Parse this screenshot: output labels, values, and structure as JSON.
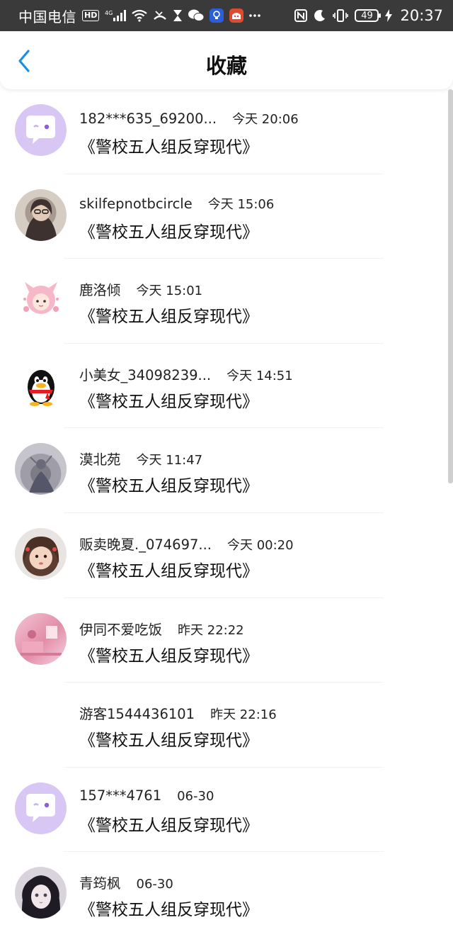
{
  "status_bar": {
    "carrier": "中国电信",
    "hd_label": "HD",
    "network": "4G",
    "battery": "49",
    "time": "20:37"
  },
  "header": {
    "title": "收藏",
    "back_icon": "chevron-left-icon",
    "accent_color": "#1a8fe3"
  },
  "list": [
    {
      "name": "182***635_69200...",
      "time": "今天 20:06",
      "book": "《警校五人组反穿现代》",
      "avatar": "chat-bubble"
    },
    {
      "name": "skilfepnotbcircle",
      "time": "今天 15:06",
      "book": "《警校五人组反穿现代》",
      "avatar": "photo"
    },
    {
      "name": "鹿洛倾",
      "time": "今天 15:01",
      "book": "《警校五人组反穿现代》",
      "avatar": "cartoon"
    },
    {
      "name": "小美女_34098239...",
      "time": "今天 14:51",
      "book": "《警校五人组反穿现代》",
      "avatar": "qq-penguin"
    },
    {
      "name": "漠北苑",
      "time": "今天 11:47",
      "book": "《警校五人组反穿现代》",
      "avatar": "photo"
    },
    {
      "name": "贩卖晚夏._074697...",
      "time": "今天 00:20",
      "book": "《警校五人组反穿现代》",
      "avatar": "photo"
    },
    {
      "name": "伊同不爱吃饭",
      "time": "昨天 22:22",
      "book": "《警校五人组反穿现代》",
      "avatar": "photo"
    },
    {
      "name": "游客1544436101",
      "time": "昨天 22:16",
      "book": "《警校五人组反穿现代》",
      "avatar": "none"
    },
    {
      "name": "157***4761",
      "time": "06-30",
      "book": "《警校五人组反穿现代》",
      "avatar": "chat-bubble"
    },
    {
      "name": "青筠枫",
      "time": "06-30",
      "book": "《警校五人组反穿现代》",
      "avatar": "photo"
    }
  ]
}
